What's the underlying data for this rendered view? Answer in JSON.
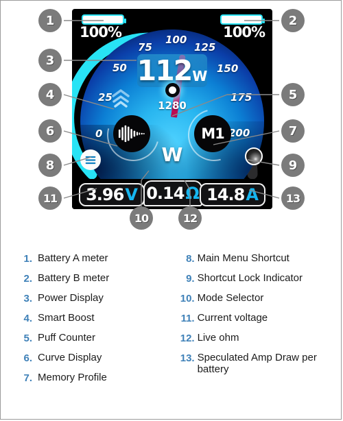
{
  "device": {
    "battery_a": {
      "percent": "100%",
      "icon": "battery-icon",
      "fill": 100
    },
    "battery_b": {
      "percent": "100%",
      "icon": "battery-icon",
      "fill": 100
    },
    "power": {
      "value": "112",
      "unit": "W"
    },
    "puff": {
      "count": "1280",
      "icon": "puff-circle-icon"
    },
    "memory": {
      "label": "M1"
    },
    "mode": {
      "label": "W"
    },
    "curve": {
      "icon": "waveform-icon"
    },
    "smart_boost": {
      "icon": "double-chevron-up-icon"
    },
    "menu": {
      "icon": "hamburger-menu-icon"
    },
    "lock": {
      "icon": "lock-sphere-icon"
    },
    "gauge": {
      "ticks": [
        "0",
        "25",
        "50",
        "75",
        "100",
        "125",
        "150",
        "175",
        "200"
      ],
      "min": 0,
      "max": 200,
      "needle_value": 112,
      "arc_active_color": "#28e3f5",
      "arc_inactive_color": "#2b2b2d",
      "needle_color": "#e8166f"
    },
    "readouts": [
      {
        "name": "voltage",
        "value": "3.96",
        "unit": "V"
      },
      {
        "name": "resistance",
        "value": "0.14",
        "unit": "Ω"
      },
      {
        "name": "amperage",
        "value": "14.8",
        "unit": "A"
      }
    ]
  },
  "callouts": [
    {
      "n": "1"
    },
    {
      "n": "2"
    },
    {
      "n": "3"
    },
    {
      "n": "4"
    },
    {
      "n": "5"
    },
    {
      "n": "6"
    },
    {
      "n": "7"
    },
    {
      "n": "8"
    },
    {
      "n": "9"
    },
    {
      "n": "10"
    },
    {
      "n": "11"
    },
    {
      "n": "12"
    },
    {
      "n": "13"
    }
  ],
  "legend": {
    "left": [
      {
        "num": "1.",
        "text": "Battery A meter"
      },
      {
        "num": "2.",
        "text": "Battery B meter"
      },
      {
        "num": "3.",
        "text": "Power Display"
      },
      {
        "num": "4.",
        "text": "Smart Boost"
      },
      {
        "num": "5.",
        "text": "Puff Counter"
      },
      {
        "num": "6.",
        "text": "Curve Display"
      },
      {
        "num": "7.",
        "text": "Memory Profile"
      }
    ],
    "right": [
      {
        "num": "8.",
        "text": "Main Menu Shortcut"
      },
      {
        "num": "9.",
        "text": "Shortcut Lock Indicator"
      },
      {
        "num": "10.",
        "text": "Mode Selector"
      },
      {
        "num": "11.",
        "text": "Current voltage"
      },
      {
        "num": "12.",
        "text": "Live ohm"
      },
      {
        "num": "13.",
        "text": "Speculated Amp Draw per battery"
      }
    ]
  },
  "colors": {
    "accent": "#28e3f5",
    "legend_number": "#3f81b8",
    "callout_bg": "#7b7b7b",
    "readout_unit": "#16b6f0"
  }
}
